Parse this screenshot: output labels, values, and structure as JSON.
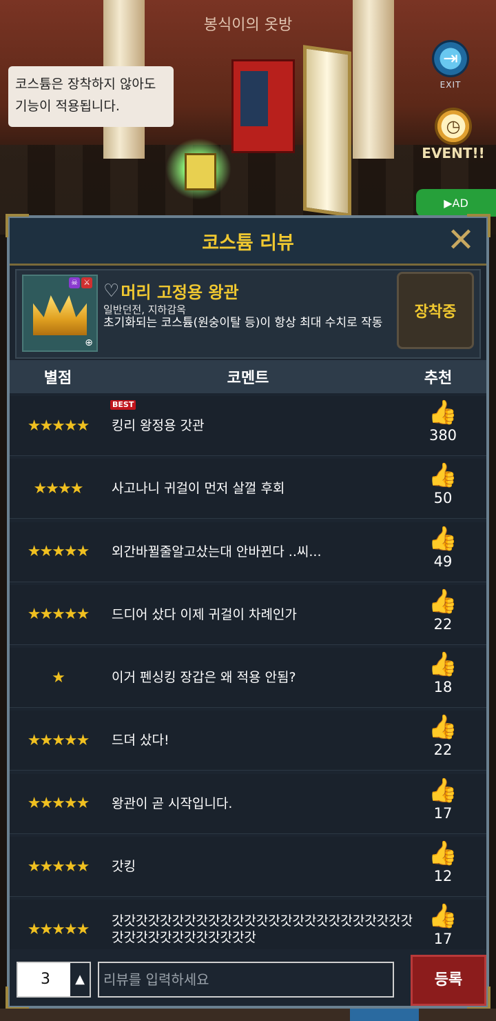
{
  "scene": {
    "room_title": "봉식이의 옷방",
    "bubble_text": "코스튬은 장착하지 않아도 기능이 적용됩니다.",
    "exit_label": "EXIT",
    "exit_icon": "exit-door-icon",
    "event_label": "EVENT!!",
    "event_icon": "clock-icon",
    "ad_label": "▶AD"
  },
  "panel": {
    "title": "코스튬 리뷰",
    "close_icon": "close-icon"
  },
  "item": {
    "name": "머리 고정용 왕관",
    "sub": "일반던전, 지하감옥",
    "desc": "초기화되는 코스튬(원숭이탈 등)이 항상 최대 수치로 작동",
    "equip_label": "장착중"
  },
  "table": {
    "col_rating": "별점",
    "col_comment": "코멘트",
    "col_like": "추천"
  },
  "reviews": [
    {
      "stars": "★★★★★",
      "comment": "킹리 왕정용 갓관",
      "likes": "380",
      "best": "BEST"
    },
    {
      "stars": "★★★★",
      "comment": "사고나니 귀걸이 먼저 살껄 후회",
      "likes": "50"
    },
    {
      "stars": "★★★★★",
      "comment": "외간바뀔줄알고샀는대 안바뀐다 ..씨...",
      "likes": "49"
    },
    {
      "stars": "★★★★★",
      "comment": "드디어 샀다 이제 귀걸이 차례인가",
      "likes": "22"
    },
    {
      "stars": "★",
      "comment": "이거 펜싱킹 장갑은 왜 적용 안됨?",
      "likes": "18"
    },
    {
      "stars": "★★★★★",
      "comment": "드뎌 샀다!",
      "likes": "22"
    },
    {
      "stars": "★★★★★",
      "comment": "왕관이 곧 시작입니다.",
      "likes": "17"
    },
    {
      "stars": "★★★★★",
      "comment": "갓킹",
      "likes": "12"
    },
    {
      "stars": "★★★★★",
      "comment": "갓갓갓갓갓갓갓갓갓갓갓갓갓갓갓갓갓갓갓갓갓갓갓갓갓갓갓갓갓갓갓갓갓갓갓갓갓",
      "likes": "17"
    }
  ],
  "input": {
    "star_value": "3",
    "placeholder": "리뷰를 입력하세요",
    "submit_label": "등록"
  }
}
